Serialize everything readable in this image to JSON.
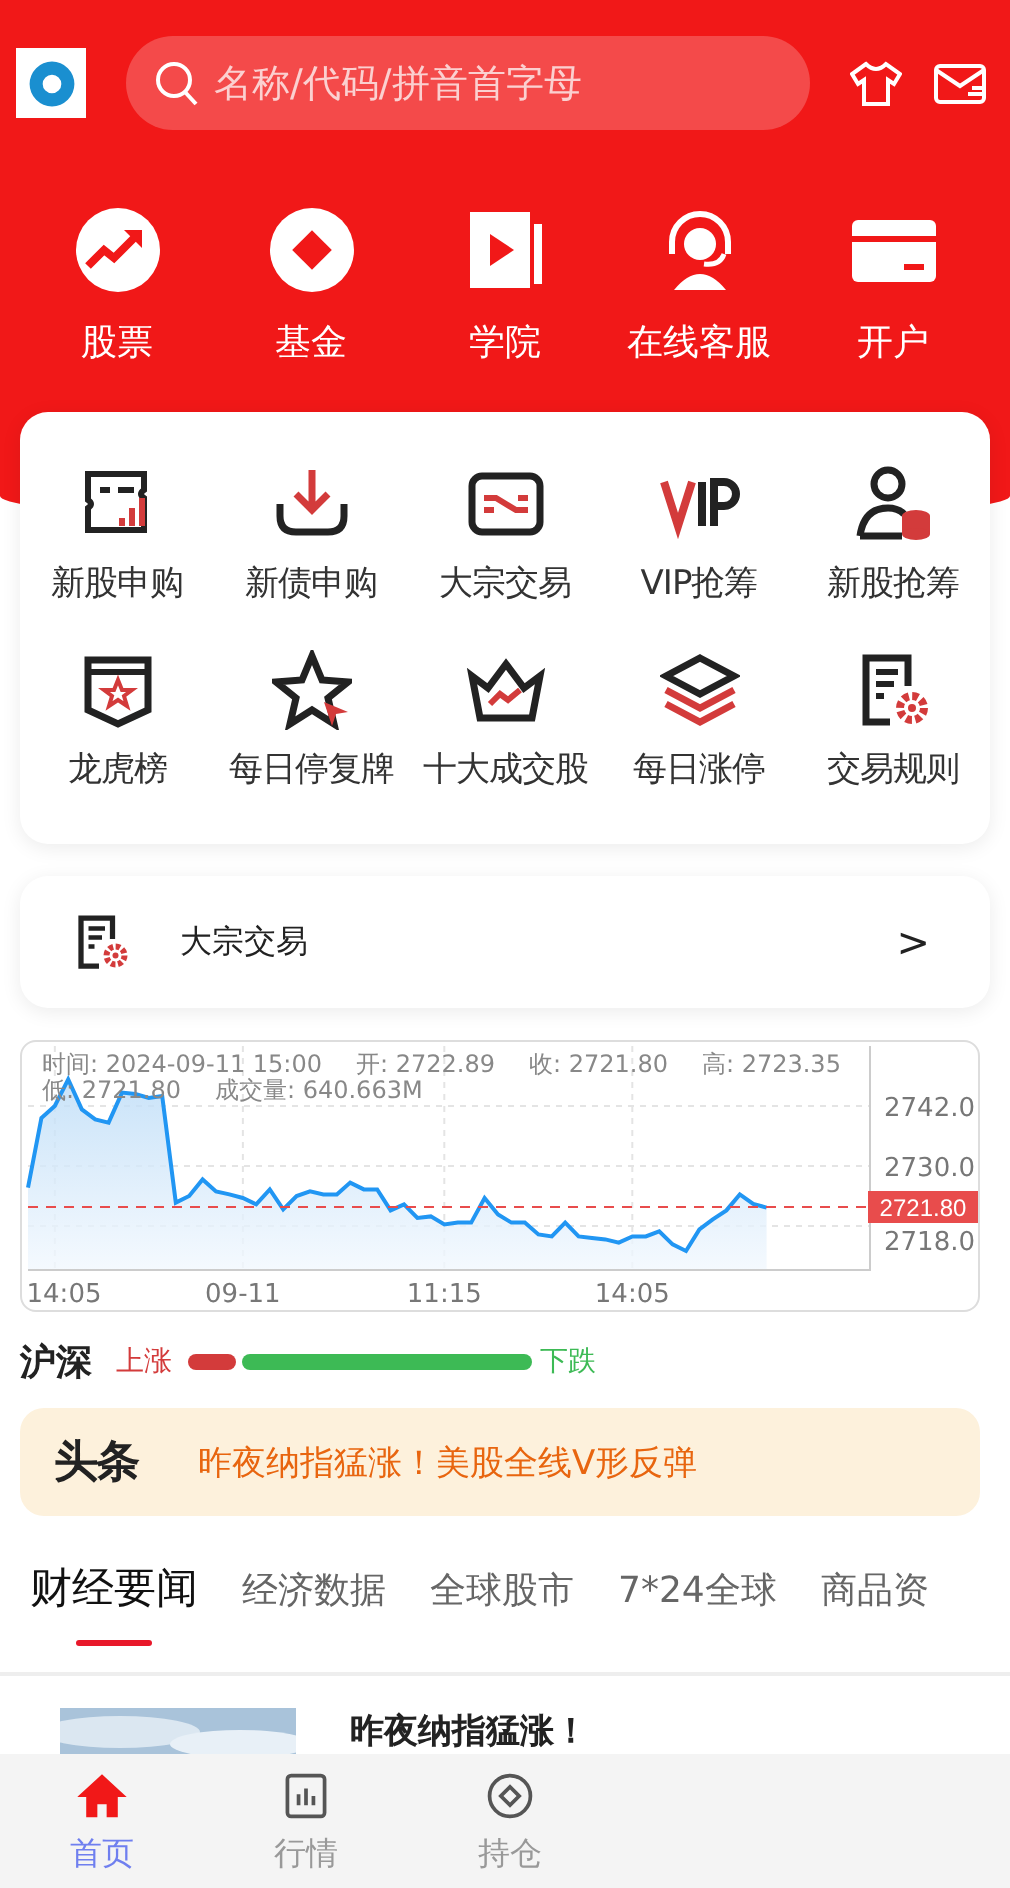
{
  "header": {
    "search": {
      "placeholder": "名称/代码/拼音首字母"
    },
    "nav": [
      "股票",
      "基金",
      "学院",
      "在线客服",
      "开户"
    ]
  },
  "grid": [
    "新股申购",
    "新债申购",
    "大宗交易",
    "VIP抢筹",
    "新股抢筹",
    "龙虎榜",
    "每日停复牌",
    "十大成交股",
    "每日涨停",
    "交易规则"
  ],
  "link_card": {
    "label": "大宗交易",
    "arrow": ">"
  },
  "chart": {
    "info": [
      "时间: 2024-09-11 15:00",
      "开: 2722.89",
      "收: 2721.80",
      "高: 2723.35",
      "低: 2721.80",
      "成交量: 640.663M"
    ],
    "chart_data": {
      "type": "area",
      "categories": [
        null,
        null,
        "14:05",
        null,
        null,
        null,
        null,
        null,
        null,
        null,
        null,
        null,
        null,
        null,
        null,
        null,
        "09-11",
        null,
        null,
        null,
        null,
        null,
        null,
        null,
        null,
        null,
        null,
        null,
        null,
        null,
        null,
        "11:15",
        null,
        null,
        null,
        null,
        null,
        null,
        null,
        null,
        null,
        null,
        null,
        null,
        null,
        "14:05",
        null,
        null,
        null,
        null,
        null,
        null,
        null,
        null,
        null,
        null
      ],
      "series": [
        {
          "color": "#2196f3",
          "values": [
            2725.7,
            2739.6,
            2742,
            2747.3,
            2741.3,
            2739.3,
            2738.7,
            2744.7,
            2744.4,
            2743.6,
            2744,
            2722.7,
            2724,
            2727.3,
            2724.9,
            2724.3,
            2723.6,
            2722.3,
            2725.3,
            2721.3,
            2724,
            2724.9,
            2724.3,
            2724.3,
            2726.7,
            2725.3,
            2725.3,
            2721.1,
            2722.3,
            2719.6,
            2719.9,
            2718.3,
            2718.7,
            2718.7,
            2723.6,
            2720.3,
            2718.7,
            2718.7,
            2716.3,
            2715.9,
            2718.7,
            2715.9,
            2715.6,
            2715.3,
            2714.7,
            2715.9,
            2715.9,
            2716.9,
            2714.3,
            2713,
            2717.3,
            2719.3,
            2721.1,
            2724.3,
            2722.4,
            2721.7
          ]
        }
      ],
      "ylim": [
        2709.2,
        2754
      ],
      "grid": true,
      "yticks": [
        {
          "value": 2742,
          "label": "2742.0"
        },
        {
          "value": 2730,
          "label": "2730.0"
        },
        {
          "value": 2718,
          "label": "2718.0"
        }
      ],
      "ref_lines": [
        {
          "axis": "y",
          "value": 2721.8,
          "label": "2721.80"
        }
      ]
    }
  },
  "market": {
    "title": "沪深",
    "up_label": "上涨",
    "down_label": "下跌",
    "level": 0.14
  },
  "headline": {
    "logo": "头条",
    "text": "昨夜纳指猛涨！美股全线V形反弹"
  },
  "tabs": [
    {
      "label": "财经要闻",
      "selected": true
    },
    {
      "label": "经济数据",
      "selected": false
    },
    {
      "label": "全球股市",
      "selected": false
    },
    {
      "label": "7*24全球",
      "selected": false
    },
    {
      "label": "商品资",
      "selected": false
    }
  ],
  "news": [
    {
      "kind": "picture",
      "title": "昨夜纳指猛涨！"
    }
  ],
  "bottom_nav": [
    {
      "label": "首页",
      "selected": true
    },
    {
      "label": "行情",
      "selected": false
    },
    {
      "label": "持仓",
      "selected": false
    }
  ]
}
